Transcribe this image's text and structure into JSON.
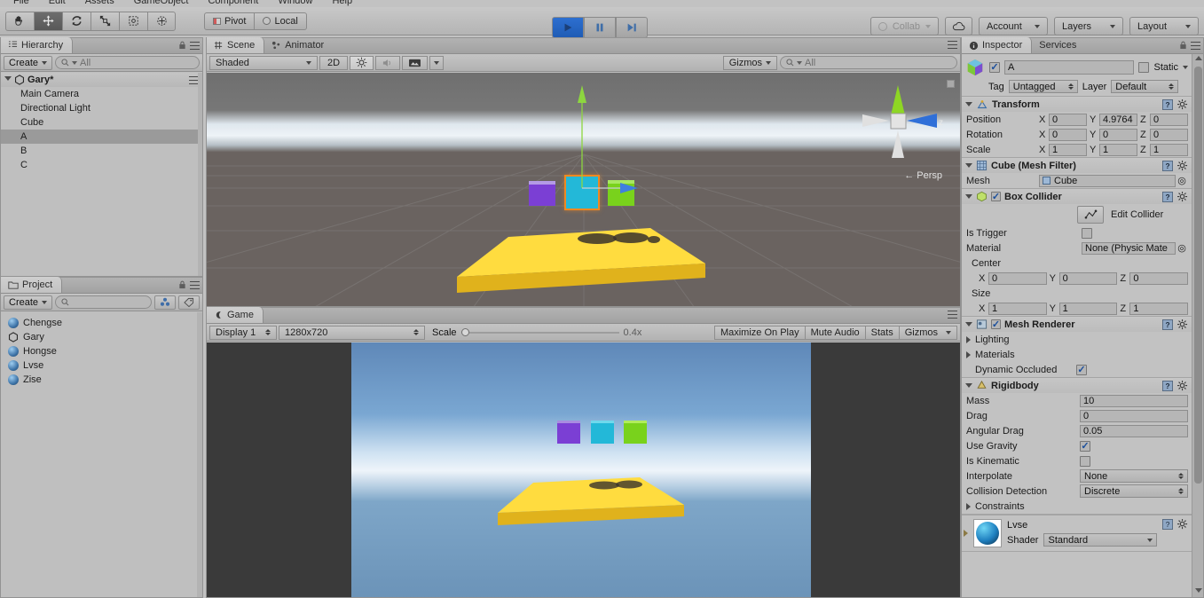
{
  "menu": {
    "items": [
      "File",
      "Edit",
      "Assets",
      "GameObject",
      "Component",
      "Window",
      "Help"
    ]
  },
  "toolbar": {
    "tools": [
      {
        "name": "hand-tool",
        "active": false
      },
      {
        "name": "move-tool",
        "active": true
      },
      {
        "name": "rotate-tool",
        "active": false
      },
      {
        "name": "scale-tool",
        "active": false
      },
      {
        "name": "rect-tool",
        "active": false
      },
      {
        "name": "transform-tool",
        "active": false
      }
    ],
    "pivot_label": "Pivot",
    "local_label": "Local",
    "play_label": "Play",
    "pause_label": "Pause",
    "step_label": "Step",
    "collab_label": "Collab",
    "cloud_label": "Cloud",
    "account_label": "Account",
    "layers_label": "Layers",
    "layout_label": "Layout"
  },
  "hierarchy": {
    "tab": "Hierarchy",
    "create_label": "Create",
    "search_placeholder": "All",
    "root": "Gary*",
    "items": [
      {
        "label": "Main Camera",
        "selected": false
      },
      {
        "label": "Directional Light",
        "selected": false
      },
      {
        "label": "Cube",
        "selected": false
      },
      {
        "label": "A",
        "selected": true
      },
      {
        "label": "B",
        "selected": false
      },
      {
        "label": "C",
        "selected": false
      }
    ]
  },
  "project": {
    "tab": "Project",
    "create_label": "Create",
    "search_placeholder": "",
    "items": [
      {
        "label": "Chengse",
        "icon": "material-icon"
      },
      {
        "label": "Gary",
        "icon": "unity-scene-icon"
      },
      {
        "label": "Hongse",
        "icon": "material-icon"
      },
      {
        "label": "Lvse",
        "icon": "material-icon"
      },
      {
        "label": "Zise",
        "icon": "material-icon"
      }
    ]
  },
  "scene": {
    "tabs": [
      {
        "label": "Scene",
        "selected": true
      },
      {
        "label": "Animator",
        "selected": false
      }
    ],
    "shading_label": "Shaded",
    "mode_2d_label": "2D",
    "lighting_icon": "sun-icon",
    "audio_icon": "speaker-icon",
    "fx_icon": "image-icon",
    "gizmos_label": "Gizmos",
    "search_placeholder": "All",
    "persp_label": "Persp",
    "gizmo_axis_z": "z"
  },
  "game": {
    "tab": "Game",
    "display_label": "Display 1",
    "resolution_label": "1280x720",
    "scale_label": "Scale",
    "scale_value": "0.4x",
    "maximize_label": "Maximize On Play",
    "mute_label": "Mute Audio",
    "stats_label": "Stats",
    "gizmos_label": "Gizmos"
  },
  "inspector": {
    "tabs": [
      {
        "label": "Inspector",
        "selected": true
      },
      {
        "label": "Services",
        "selected": false
      }
    ],
    "object_name": "A",
    "object_enabled": true,
    "static_label": "Static",
    "static_checked": false,
    "tag_label": "Tag",
    "tag_value": "Untagged",
    "layer_label": "Layer",
    "layer_value": "Default",
    "components": [
      {
        "name": "Transform",
        "icon": "transform-icon",
        "has_checkbox": false,
        "rows": [
          {
            "label": "Position",
            "x": "0",
            "y": "4.9764",
            "z": "0"
          },
          {
            "label": "Rotation",
            "x": "0",
            "y": "0",
            "z": "0"
          },
          {
            "label": "Scale",
            "x": "1",
            "y": "1",
            "z": "1"
          }
        ]
      },
      {
        "name": "Cube (Mesh Filter)",
        "icon": "mesh-filter-icon",
        "has_checkbox": false,
        "mesh_label": "Mesh",
        "mesh_value": "Cube"
      },
      {
        "name": "Box Collider",
        "icon": "box-collider-icon",
        "has_checkbox": true,
        "checked": true,
        "edit_collider_label": "Edit Collider",
        "is_trigger_label": "Is Trigger",
        "is_trigger_checked": false,
        "material_label": "Material",
        "material_value": "None (Physic Mate",
        "center_label": "Center",
        "center": {
          "x": "0",
          "y": "0",
          "z": "0"
        },
        "size_label": "Size",
        "size": {
          "x": "1",
          "y": "1",
          "z": "1"
        }
      },
      {
        "name": "Mesh Renderer",
        "icon": "mesh-renderer-icon",
        "has_checkbox": true,
        "checked": true,
        "lighting_label": "Lighting",
        "materials_label": "Materials",
        "dynamic_occluded_label": "Dynamic Occluded",
        "dynamic_occluded_checked": true
      },
      {
        "name": "Rigidbody",
        "icon": "rigidbody-icon",
        "has_checkbox": false,
        "mass_label": "Mass",
        "mass_value": "10",
        "drag_label": "Drag",
        "drag_value": "0",
        "angular_drag_label": "Angular Drag",
        "angular_drag_value": "0.05",
        "use_gravity_label": "Use Gravity",
        "use_gravity_checked": true,
        "is_kinematic_label": "Is Kinematic",
        "is_kinematic_checked": false,
        "interpolate_label": "Interpolate",
        "interpolate_value": "None",
        "collision_detection_label": "Collision Detection",
        "collision_detection_value": "Discrete",
        "constraints_label": "Constraints"
      }
    ],
    "material": {
      "name": "Lvse",
      "shader_label": "Shader",
      "shader_value": "Standard"
    }
  },
  "colors": {
    "cube_purple": "#7b3fd4",
    "cube_cyan": "#23b8d8",
    "cube_green": "#79d21c",
    "platform_yellow": "#f8d130",
    "selection_orange": "#f08820",
    "accent_blue": "#2d6fd0"
  }
}
